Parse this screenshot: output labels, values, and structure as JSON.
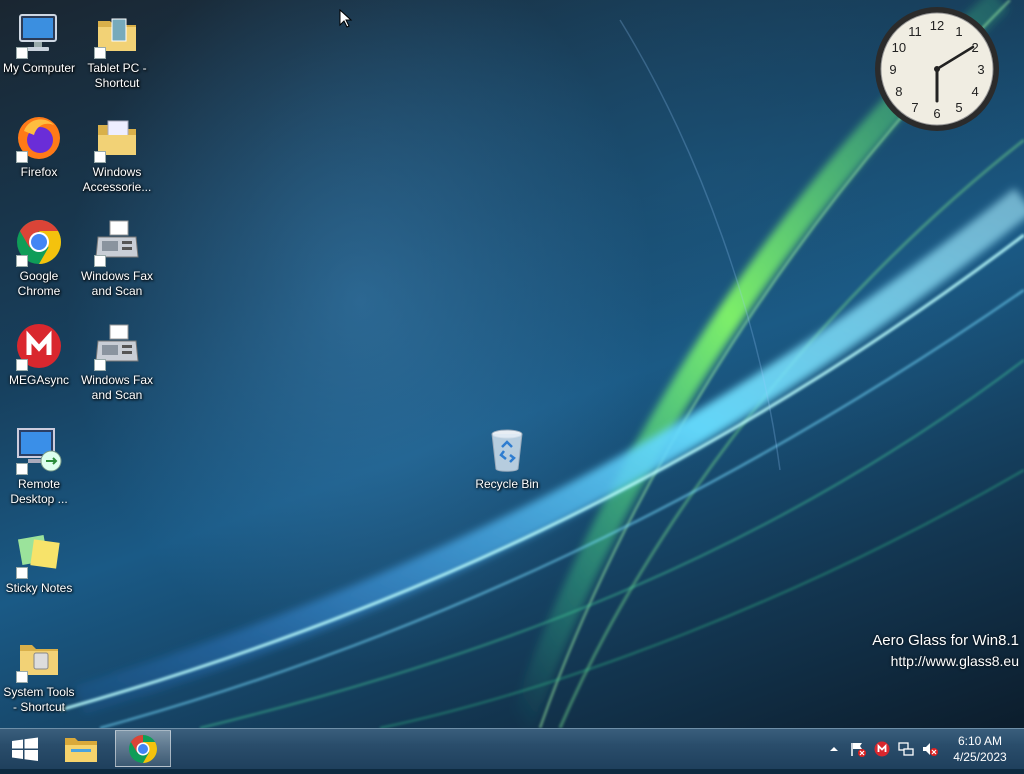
{
  "desktop": {
    "icons": [
      {
        "label": "My Computer",
        "icon": "my-computer-icon",
        "shortcut": true
      },
      {
        "label": "Tablet PC - Shortcut",
        "icon": "folder-icon",
        "shortcut": true
      },
      {
        "label": "Firefox",
        "icon": "firefox-icon",
        "shortcut": true
      },
      {
        "label": "Windows Accessorie...",
        "icon": "folder-icon",
        "shortcut": true
      },
      {
        "label": "Google Chrome",
        "icon": "chrome-icon",
        "shortcut": true
      },
      {
        "label": "Windows Fax and Scan",
        "icon": "fax-icon",
        "shortcut": true
      },
      {
        "label": "MEGAsync",
        "icon": "mega-icon",
        "shortcut": true
      },
      {
        "label": "Windows Fax and Scan",
        "icon": "fax-icon",
        "shortcut": true
      },
      {
        "label": "Remote Desktop ...",
        "icon": "remote-desktop-icon",
        "shortcut": true
      },
      {
        "label": "Sticky Notes",
        "icon": "sticky-notes-icon",
        "shortcut": true
      },
      {
        "label": "System Tools - Shortcut",
        "icon": "folder-icon",
        "shortcut": true
      },
      {
        "label": "Recycle Bin",
        "icon": "recycle-bin-icon",
        "shortcut": false
      }
    ],
    "watermark": {
      "line1": "Aero Glass for Win8.1",
      "line2": "http://www.glass8.eu"
    },
    "clock_gadget": {
      "numerals": [
        "12",
        "1",
        "2",
        "3",
        "4",
        "5",
        "6",
        "7",
        "8",
        "9",
        "10",
        "11"
      ],
      "time": "6:10"
    }
  },
  "taskbar": {
    "start_icon": "windows-logo-icon",
    "pinned": [
      {
        "name": "File Explorer",
        "icon": "file-explorer-icon"
      },
      {
        "name": "Google Chrome",
        "icon": "chrome-icon",
        "active": true
      }
    ],
    "tray": [
      "chevron-up-icon",
      "action-center-flag-icon",
      "mega-icon",
      "network-icon",
      "volume-muted-icon"
    ],
    "clock": {
      "time": "6:10 AM",
      "date": "4/25/2023"
    }
  },
  "colors": {
    "taskbar": "#2a4d6b",
    "chrome_red": "#db4437",
    "chrome_yellow": "#f4c20d",
    "chrome_green": "#0f9d58",
    "chrome_blue": "#4285f4",
    "mega_red": "#d9272e",
    "folder_yellow": "#e8c35a"
  }
}
